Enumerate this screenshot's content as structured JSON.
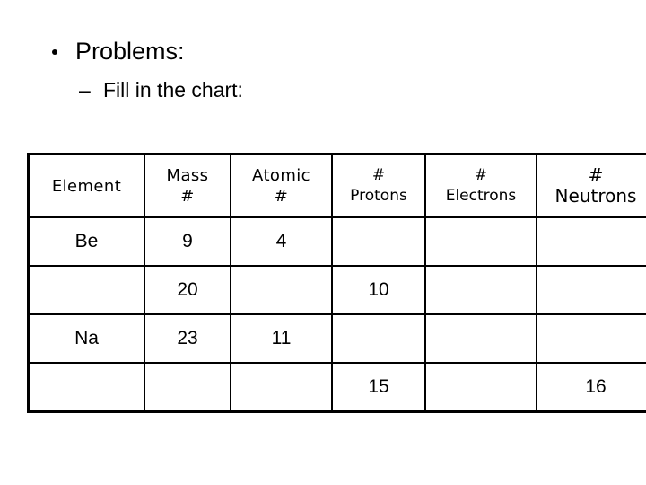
{
  "slide": {
    "bullets": {
      "level1": "Problems:",
      "level1_marker": "bullet-dot",
      "level2": "Fill in the chart:",
      "level2_marker": "–"
    },
    "table": {
      "headers": [
        {
          "line1": "Element",
          "line2": ""
        },
        {
          "line1": "Mass",
          "line2": "#"
        },
        {
          "line1": "Atomic",
          "line2": "#"
        },
        {
          "line1": "#",
          "line2": "Protons"
        },
        {
          "line1": "#",
          "line2": "Electrons"
        },
        {
          "line1": "#",
          "line2": "Neutrons"
        }
      ],
      "rows": [
        {
          "element": "Be",
          "mass": "9",
          "atomic": "4",
          "protons": "",
          "electrons": "",
          "neutrons": ""
        },
        {
          "element": "",
          "mass": "20",
          "atomic": "",
          "protons": "10",
          "electrons": "",
          "neutrons": ""
        },
        {
          "element": "Na",
          "mass": "23",
          "atomic": "11",
          "protons": "",
          "electrons": "",
          "neutrons": ""
        },
        {
          "element": "",
          "mass": "",
          "atomic": "",
          "protons": "15",
          "electrons": "",
          "neutrons": "16"
        }
      ]
    },
    "colors": {
      "background": "#ffffff",
      "text": "#000000",
      "border": "#000000"
    }
  }
}
